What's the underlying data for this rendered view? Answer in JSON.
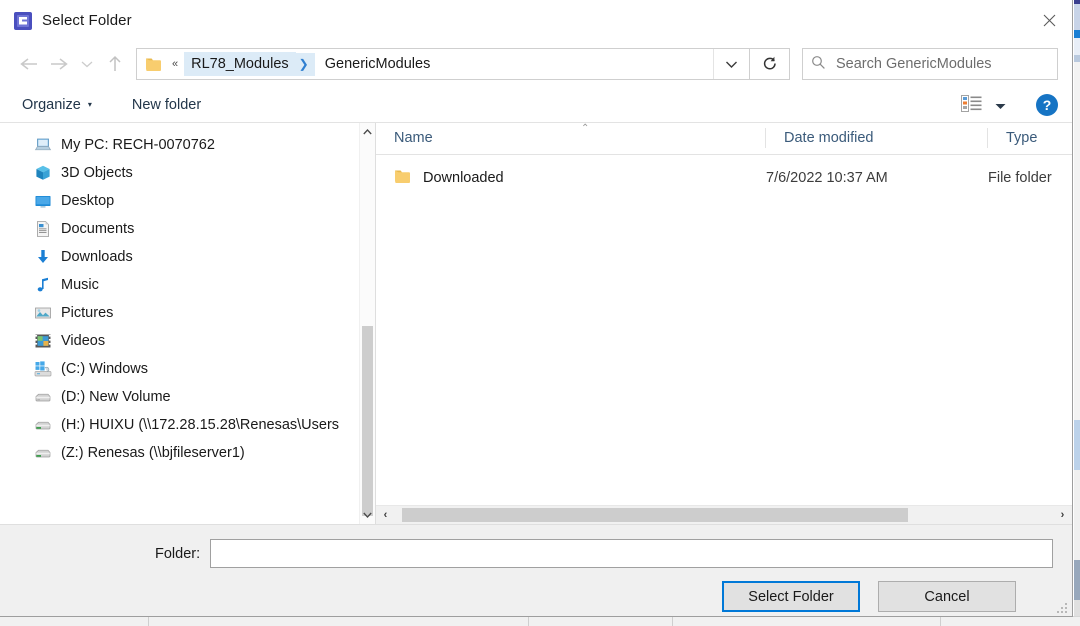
{
  "window": {
    "title": "Select Folder",
    "icon": "chip-icon",
    "close_label": "close-icon"
  },
  "addressbar": {
    "back_icon": "arrow-left-icon",
    "forward_icon": "arrow-right-icon",
    "recent_icon": "chevron-down-icon",
    "up_icon": "arrow-up-icon",
    "folder_icon": "folder-icon",
    "overflow_sep": "«",
    "crumbs": [
      {
        "label": "RL78_Modules",
        "active": true
      },
      {
        "label": "GenericModules",
        "active": false
      }
    ],
    "dropdown_icon": "chevron-down-icon",
    "refresh_icon": "refresh-icon",
    "search": {
      "placeholder": "Search GenericModules",
      "value": "",
      "icon": "search-icon"
    }
  },
  "toolbar": {
    "organize_label": "Organize",
    "organize_caret": "▾",
    "new_folder_label": "New folder",
    "view_icon": "view-layout-icon",
    "view_caret": "▾",
    "help_label": "?"
  },
  "navpane": {
    "items": [
      {
        "label": "My PC: RECH-0070762",
        "icon": "computer-icon"
      },
      {
        "label": "3D Objects",
        "icon": "3d-objects-icon"
      },
      {
        "label": "Desktop",
        "icon": "desktop-icon"
      },
      {
        "label": "Documents",
        "icon": "documents-icon"
      },
      {
        "label": "Downloads",
        "icon": "downloads-icon"
      },
      {
        "label": "Music",
        "icon": "music-icon"
      },
      {
        "label": "Pictures",
        "icon": "pictures-icon"
      },
      {
        "label": "Videos",
        "icon": "videos-icon"
      },
      {
        "label": "(C:) Windows",
        "icon": "windows-drive-icon"
      },
      {
        "label": "(D:) New Volume",
        "icon": "drive-icon"
      },
      {
        "label": "(H:) HUIXU (\\\\172.28.15.28\\Renesas\\Users",
        "icon": "network-drive-icon"
      },
      {
        "label": "(Z:) Renesas (\\\\bjfileserver1)",
        "icon": "network-drive-icon"
      }
    ],
    "scroll_up_icon": "chevron-up-icon",
    "scroll_down_icon": "chevron-down-icon"
  },
  "filepane": {
    "columns": [
      {
        "label": "Name",
        "sorted": "ascending"
      },
      {
        "label": "Date modified",
        "sorted": ""
      },
      {
        "label": "Type",
        "sorted": ""
      }
    ],
    "sort_caret": "⌃",
    "rows": [
      {
        "name": "Downloaded",
        "date_modified": "7/6/2022 10:37 AM",
        "type": "File folder",
        "icon": "folder-icon"
      }
    ],
    "hscroll": {
      "left_icon": "‹",
      "right_icon": "›"
    }
  },
  "footer": {
    "folder_label": "Folder:",
    "folder_value": "",
    "folder_placeholder": "",
    "select_button": "Select Folder",
    "cancel_button": "Cancel"
  },
  "background": {
    "ghost_text_left": "",
    "ghost_text_mid": ""
  },
  "colors": {
    "accent": "#0078d7",
    "crumb_highlight": "#dcebf7",
    "header_text": "#3a5a7a",
    "help_blue": "#1674c4",
    "folder_yellow": "#f7c766",
    "scroll_thumb": "#cdcdcd"
  }
}
